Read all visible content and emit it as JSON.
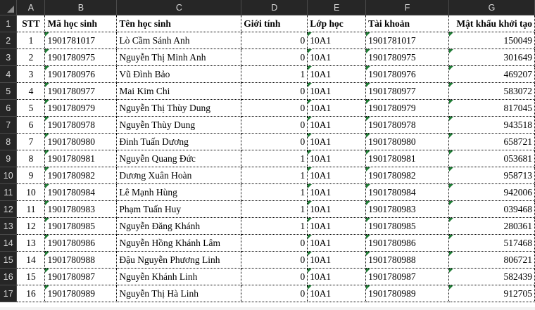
{
  "columns": [
    "A",
    "B",
    "C",
    "D",
    "E",
    "F",
    "G"
  ],
  "header": {
    "stt": "STT",
    "ma_hoc_sinh": "Mã học sinh",
    "ten_hoc_sinh": "Tên học sinh",
    "gioi_tinh": "Giới tính",
    "lop_hoc": "Lớp học",
    "tai_khoan": "Tài khoản",
    "mat_khau": "Mật khẩu khởi tạo"
  },
  "rows": [
    {
      "rownum": "1",
      "stt": "",
      "ma": "",
      "ten": "",
      "gt": "",
      "lop": "",
      "tk": "",
      "mk": ""
    },
    {
      "rownum": "2",
      "stt": "1",
      "ma": "1901781017",
      "ten": "Lò Cầm Sánh Anh",
      "gt": "0",
      "lop": "10A1",
      "tk": "1901781017",
      "mk": "150049"
    },
    {
      "rownum": "3",
      "stt": "2",
      "ma": "1901780975",
      "ten": "Nguyễn Thị Minh Anh",
      "gt": "0",
      "lop": "10A1",
      "tk": "1901780975",
      "mk": "301649"
    },
    {
      "rownum": "4",
      "stt": "3",
      "ma": "1901780976",
      "ten": "Vũ Đình Bảo",
      "gt": "1",
      "lop": "10A1",
      "tk": "1901780976",
      "mk": "469207"
    },
    {
      "rownum": "5",
      "stt": "4",
      "ma": "1901780977",
      "ten": "Mai Kim Chi",
      "gt": "0",
      "lop": "10A1",
      "tk": "1901780977",
      "mk": "583072"
    },
    {
      "rownum": "6",
      "stt": "5",
      "ma": "1901780979",
      "ten": "Nguyễn Thị Thùy Dung",
      "gt": "0",
      "lop": "10A1",
      "tk": "1901780979",
      "mk": "817045"
    },
    {
      "rownum": "7",
      "stt": "6",
      "ma": "1901780978",
      "ten": "Nguyễn Thùy Dung",
      "gt": "0",
      "lop": "10A1",
      "tk": "1901780978",
      "mk": "943518"
    },
    {
      "rownum": "8",
      "stt": "7",
      "ma": "1901780980",
      "ten": "Đinh Tuấn Dương",
      "gt": "0",
      "lop": "10A1",
      "tk": "1901780980",
      "mk": "658721"
    },
    {
      "rownum": "9",
      "stt": "8",
      "ma": "1901780981",
      "ten": "Nguyễn Quang Đức",
      "gt": "1",
      "lop": "10A1",
      "tk": "1901780981",
      "mk": "053681"
    },
    {
      "rownum": "10",
      "stt": "9",
      "ma": "1901780982",
      "ten": "Dương Xuân Hoàn",
      "gt": "1",
      "lop": "10A1",
      "tk": "1901780982",
      "mk": "958713"
    },
    {
      "rownum": "11",
      "stt": "10",
      "ma": "1901780984",
      "ten": "Lê Mạnh Hùng",
      "gt": "1",
      "lop": "10A1",
      "tk": "1901780984",
      "mk": "942006"
    },
    {
      "rownum": "12",
      "stt": "11",
      "ma": "1901780983",
      "ten": "Phạm Tuấn Huy",
      "gt": "1",
      "lop": "10A1",
      "tk": "1901780983",
      "mk": "039468"
    },
    {
      "rownum": "13",
      "stt": "12",
      "ma": "1901780985",
      "ten": "Nguyễn Đăng Khánh",
      "gt": "1",
      "lop": "10A1",
      "tk": "1901780985",
      "mk": "280361"
    },
    {
      "rownum": "14",
      "stt": "13",
      "ma": "1901780986",
      "ten": "Nguyễn Hồng Khánh Lâm",
      "gt": "0",
      "lop": "10A1",
      "tk": "1901780986",
      "mk": "517468"
    },
    {
      "rownum": "15",
      "stt": "14",
      "ma": "1901780988",
      "ten": "Đậu Nguyễn Phương Linh",
      "gt": "0",
      "lop": "10A1",
      "tk": "1901780988",
      "mk": "806721"
    },
    {
      "rownum": "16",
      "stt": "15",
      "ma": "1901780987",
      "ten": "Nguyễn Khánh Linh",
      "gt": "0",
      "lop": "10A1",
      "tk": "1901780987",
      "mk": "582439"
    },
    {
      "rownum": "17",
      "stt": "16",
      "ma": "1901780989",
      "ten": "Nguyễn Thị Hà Linh",
      "gt": "0",
      "lop": "10A1",
      "tk": "1901780989",
      "mk": "912705"
    }
  ]
}
